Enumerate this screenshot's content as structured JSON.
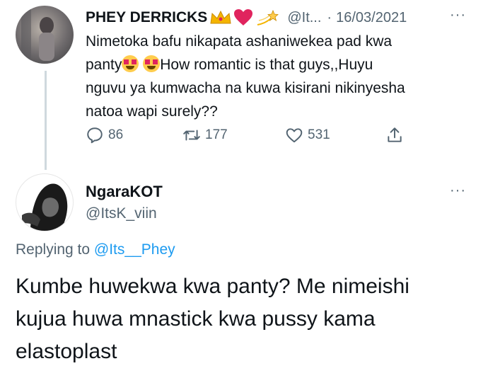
{
  "tweet1": {
    "display_name": "PHEY DERRICKS",
    "handle": "@It...",
    "separator": "·",
    "date": "16/03/2021",
    "text_line1": "Nimetoka bafu nikapata ashaniwekea pad kwa",
    "text_line2_pre": "panty",
    "text_line2_post": "How romantic is that guys,,Huyu",
    "text_line3": "nguvu ya kumwacha na kuwa kisirani nikinyesha",
    "text_line4": "natoa wapi surely??",
    "replies": "86",
    "retweets": "177",
    "likes": "531",
    "more": "···"
  },
  "tweet2": {
    "display_name": "NgaraKOT",
    "handle": "@ItsK_viin",
    "more": "···",
    "replying_prefix": "Replying to ",
    "replying_handle": "@Its__Phey",
    "text_line1": "Kumbe huwekwa kwa panty? Me nimeishi",
    "text_line2": "kujua huwa mnastick kwa pussy kama",
    "text_line3": "elastoplast"
  },
  "colors": {
    "accent": "#1d9bf0",
    "muted": "#536471",
    "heart": "#e0245e",
    "crown": "#f4b400"
  }
}
